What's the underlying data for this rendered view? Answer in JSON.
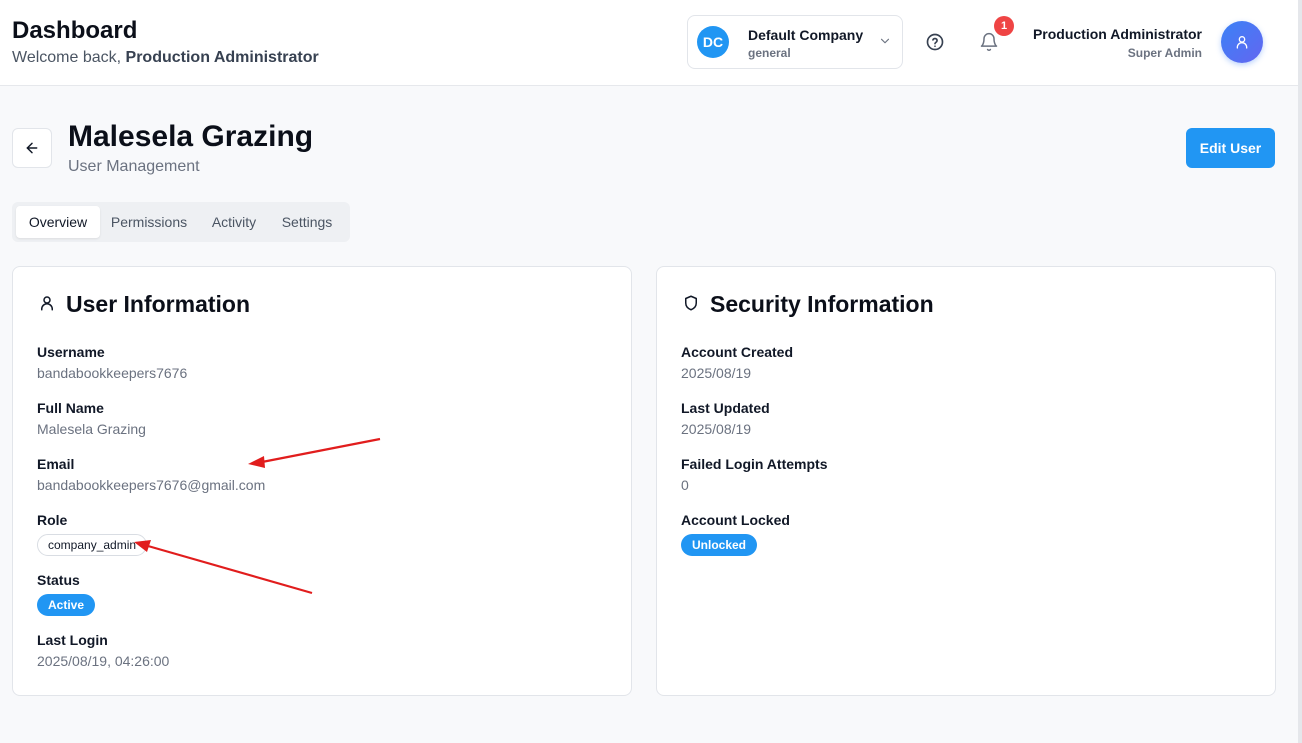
{
  "header": {
    "title": "Dashboard",
    "welcome_prefix": "Welcome back, ",
    "welcome_name": "Production Administrator"
  },
  "company": {
    "initials": "DC",
    "name": "Default Company",
    "sub": "general",
    "icon": "chevron-down-icon"
  },
  "notifications": {
    "count": "1",
    "icon": "bell-icon"
  },
  "help": {
    "icon": "help-circle-icon"
  },
  "user": {
    "name": "Production Administrator",
    "role": "Super Admin",
    "icon": "user-icon"
  },
  "page": {
    "title": "Malesela Grazing",
    "subtitle": "User Management",
    "edit_label": "Edit User",
    "back_icon": "arrow-left-icon"
  },
  "tabs": [
    {
      "label": "Overview",
      "active": true
    },
    {
      "label": "Permissions",
      "active": false
    },
    {
      "label": "Activity",
      "active": false
    },
    {
      "label": "Settings",
      "active": false
    }
  ],
  "user_info": {
    "title": "User Information",
    "icon": "user-icon",
    "username_label": "Username",
    "username": "bandabookkeepers7676",
    "fullname_label": "Full Name",
    "fullname": "Malesela Grazing",
    "email_label": "Email",
    "email": "bandabookkeepers7676@gmail.com",
    "role_label": "Role",
    "role": "company_admin",
    "status_label": "Status",
    "status": "Active",
    "last_login_label": "Last Login",
    "last_login": "2025/08/19, 04:26:00"
  },
  "security_info": {
    "title": "Security Information",
    "icon": "shield-icon",
    "created_label": "Account Created",
    "created": "2025/08/19",
    "updated_label": "Last Updated",
    "updated": "2025/08/19",
    "failed_label": "Failed Login Attempts",
    "failed": "0",
    "locked_label": "Account Locked",
    "locked": "Unlocked"
  },
  "colors": {
    "primary": "#2196f3",
    "badge_red": "#ef4444",
    "annotation_arrow": "#e11d1d"
  }
}
